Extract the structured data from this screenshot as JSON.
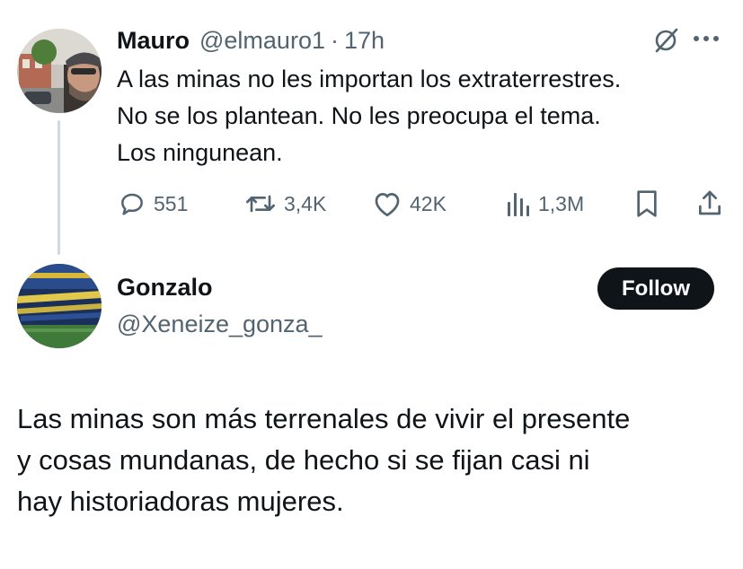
{
  "original_tweet": {
    "author_name": "Mauro",
    "handle": "@elmauro1",
    "separator": "·",
    "time": "17h",
    "lines": [
      "A las minas no les importan los extraterrestres.",
      "No se los plantean. No les preocupa el tema.",
      "Los ningunean."
    ],
    "actions": {
      "replies": "551",
      "reposts": "3,4K",
      "likes": "42K",
      "views": "1,3M"
    },
    "icons": [
      "grok-icon",
      "more-icon",
      "reply-icon",
      "repost-icon",
      "like-icon",
      "views-icon",
      "bookmark-icon",
      "share-icon"
    ]
  },
  "reply_tweet": {
    "author_name": "Gonzalo",
    "handle": "@Xeneize_gonza_",
    "follow_label": "Follow",
    "lines": [
      "Las minas son más terrenales de vivir el presente",
      "y cosas mundanas, de hecho si se fijan casi ni",
      "hay historiadoras mujeres."
    ]
  },
  "colors": {
    "text": "#0f1419",
    "secondary": "#536471",
    "thread_line": "#cfd9de",
    "follow_bg": "#0f1419"
  }
}
